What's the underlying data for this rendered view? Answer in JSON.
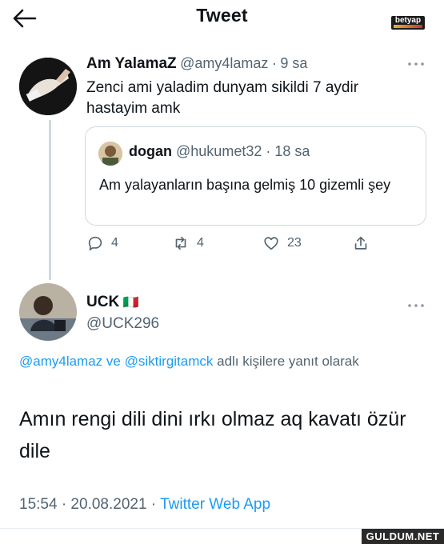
{
  "header": {
    "title": "Tweet",
    "back_icon": "arrow-left-icon",
    "brand": "betyap"
  },
  "tweet": {
    "author_name": "Am YalamaZ",
    "handle": "@amy4lamaz",
    "separator": "·",
    "time": "9 sa",
    "text": "Zenci ami yaladim dunyam sikildi 7 aydir hastayim amk",
    "more_icon": "more-horizontal-icon",
    "quote": {
      "author_name": "dogan",
      "handle": "@hukumet32",
      "separator": "·",
      "time": "18 sa",
      "text": "Am yalayanların başına gelmiş 10 gizemli şey"
    },
    "actions": {
      "replies": "4",
      "retweets": "4",
      "likes": "23"
    }
  },
  "reply": {
    "author_name": "UCK",
    "flag": "🇮🇹",
    "handle": "@UCK296",
    "replying_mention_1": "@amy4lamaz",
    "replying_and": "ve",
    "replying_mention_2": "@siktirgitamck",
    "replying_suffix": "adlı kişilere yanıt olarak",
    "text": "Amın rengi dili dini ırkı olmaz aq kavatı özür dile",
    "meta": "15:54 · 20.08.2021 ·",
    "source": "Twitter Web App"
  },
  "watermark": "GULDUM.NET",
  "colors": {
    "link": "#1d9bf0",
    "muted": "#536471",
    "border": "#cfd9de"
  }
}
